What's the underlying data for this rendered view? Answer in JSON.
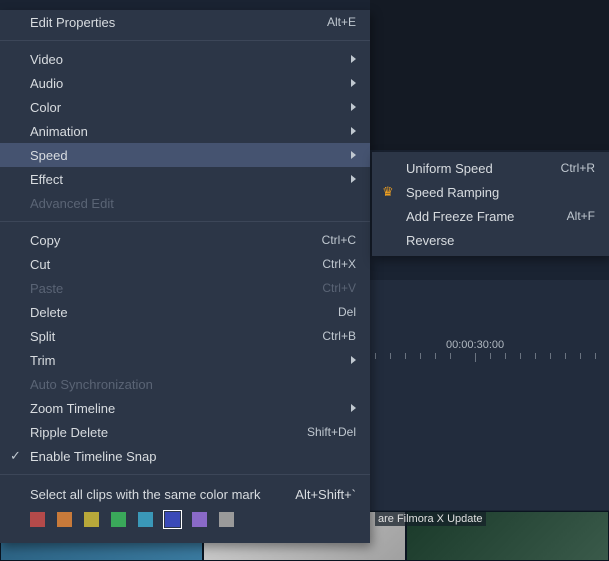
{
  "menu": {
    "editProperties": {
      "label": "Edit Properties",
      "shortcut": "Alt+E"
    },
    "video": {
      "label": "Video"
    },
    "audio": {
      "label": "Audio"
    },
    "color": {
      "label": "Color"
    },
    "animation": {
      "label": "Animation"
    },
    "speed": {
      "label": "Speed"
    },
    "effect": {
      "label": "Effect"
    },
    "advancedEdit": {
      "label": "Advanced Edit"
    },
    "copy": {
      "label": "Copy",
      "shortcut": "Ctrl+C"
    },
    "cut": {
      "label": "Cut",
      "shortcut": "Ctrl+X"
    },
    "paste": {
      "label": "Paste",
      "shortcut": "Ctrl+V"
    },
    "delete": {
      "label": "Delete",
      "shortcut": "Del"
    },
    "split": {
      "label": "Split",
      "shortcut": "Ctrl+B"
    },
    "trim": {
      "label": "Trim"
    },
    "autoSync": {
      "label": "Auto Synchronization"
    },
    "zoomTimeline": {
      "label": "Zoom Timeline"
    },
    "rippleDelete": {
      "label": "Ripple Delete",
      "shortcut": "Shift+Del"
    },
    "enableSnap": {
      "label": "Enable Timeline Snap"
    },
    "colorMark": {
      "label": "Select all clips with the same color mark",
      "shortcut": "Alt+Shift+`"
    }
  },
  "submenu": {
    "uniformSpeed": {
      "label": "Uniform Speed",
      "shortcut": "Ctrl+R"
    },
    "speedRamping": {
      "label": "Speed Ramping"
    },
    "addFreeze": {
      "label": "Add Freeze Frame",
      "shortcut": "Alt+F"
    },
    "reverse": {
      "label": "Reverse"
    }
  },
  "swatches": {
    "c0": "#b44a4a",
    "c1": "#c87a3a",
    "c2": "#b8a83a",
    "c3": "#3aa85a",
    "c4": "#3a98b8",
    "c5": "#3a4ab8",
    "c6": "#8a6ac8",
    "c7": "#9a9a9a"
  },
  "timeline": {
    "timecode": "00:00:30:00"
  },
  "thumbLabel": "are Filmora X Update"
}
